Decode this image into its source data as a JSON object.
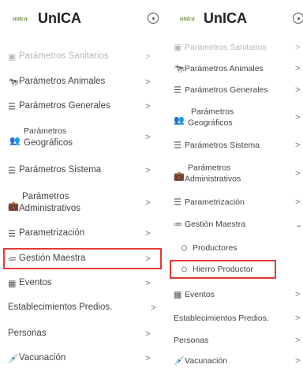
{
  "brand": {
    "logo_text": "unica",
    "name": "UnICA"
  },
  "left_menu": {
    "items": [
      {
        "label": "Parámetros Sanitarios",
        "icon": "document-gear-icon",
        "chevron": ">"
      },
      {
        "label": "Parámetros Animales",
        "icon": "cow-icon",
        "chevron": ">"
      },
      {
        "label": "Parámetros Generales",
        "icon": "sliders-icon",
        "chevron": ">"
      },
      {
        "label_line1": "Parámetros",
        "label_line2": "Geográficos",
        "icon": "map-people-icon",
        "chevron": ">"
      },
      {
        "label": "Parámetros Sistema",
        "icon": "sliders-icon",
        "chevron": ">"
      },
      {
        "label_line1": "Parámetros",
        "label_line2": "Administrativos",
        "icon": "briefcase-icon",
        "chevron": ">"
      },
      {
        "label": " Parametrización",
        "icon": "sliders-icon",
        "chevron": ">"
      },
      {
        "label": "Gestión Maestra",
        "icon": "list-check-icon",
        "chevron": ">"
      },
      {
        "label": "Eventos",
        "icon": "calendar-icon",
        "chevron": ">"
      },
      {
        "label": "Establecimientos Predios.",
        "chevron": ">"
      },
      {
        "label": "Personas",
        "chevron": ">"
      },
      {
        "label": "Vacunación",
        "icon": "syringe-icon",
        "chevron": ">"
      }
    ]
  },
  "right_menu": {
    "items": [
      {
        "label": "Parámetros Sanitarios",
        "icon": "document-gear-icon",
        "chevron": ">"
      },
      {
        "label": "Parámetros Animales",
        "icon": "cow-icon",
        "chevron": ">"
      },
      {
        "label": "Parámetros Generales",
        "icon": "sliders-icon",
        "chevron": ">"
      },
      {
        "label_line1": "Parámetros",
        "label_line2": "Geográficos",
        "icon": "map-people-icon",
        "chevron": ">"
      },
      {
        "label": "Parámetros Sistema",
        "icon": "sliders-icon",
        "chevron": ">"
      },
      {
        "label_line1": "Parámetros",
        "label_line2": "Administrativos",
        "icon": "briefcase-icon",
        "chevron": ">"
      },
      {
        "label": " Parametrización",
        "icon": "sliders-icon",
        "chevron": ">"
      },
      {
        "label": "Gestión Maestra",
        "icon": "list-check-icon",
        "chevron": "⌄"
      },
      {
        "label": "Eventos",
        "icon": "calendar-icon",
        "chevron": ">"
      },
      {
        "label": "Establecimientos Predios.",
        "chevron": ">"
      },
      {
        "label": "Personas",
        "chevron": ">"
      },
      {
        "label": "Vacunación",
        "icon": "syringe-icon",
        "chevron": ">"
      }
    ],
    "submenu": [
      {
        "label": "Productores"
      },
      {
        "label": "Hierro Productor"
      }
    ]
  },
  "highlight_color": "#e53935"
}
